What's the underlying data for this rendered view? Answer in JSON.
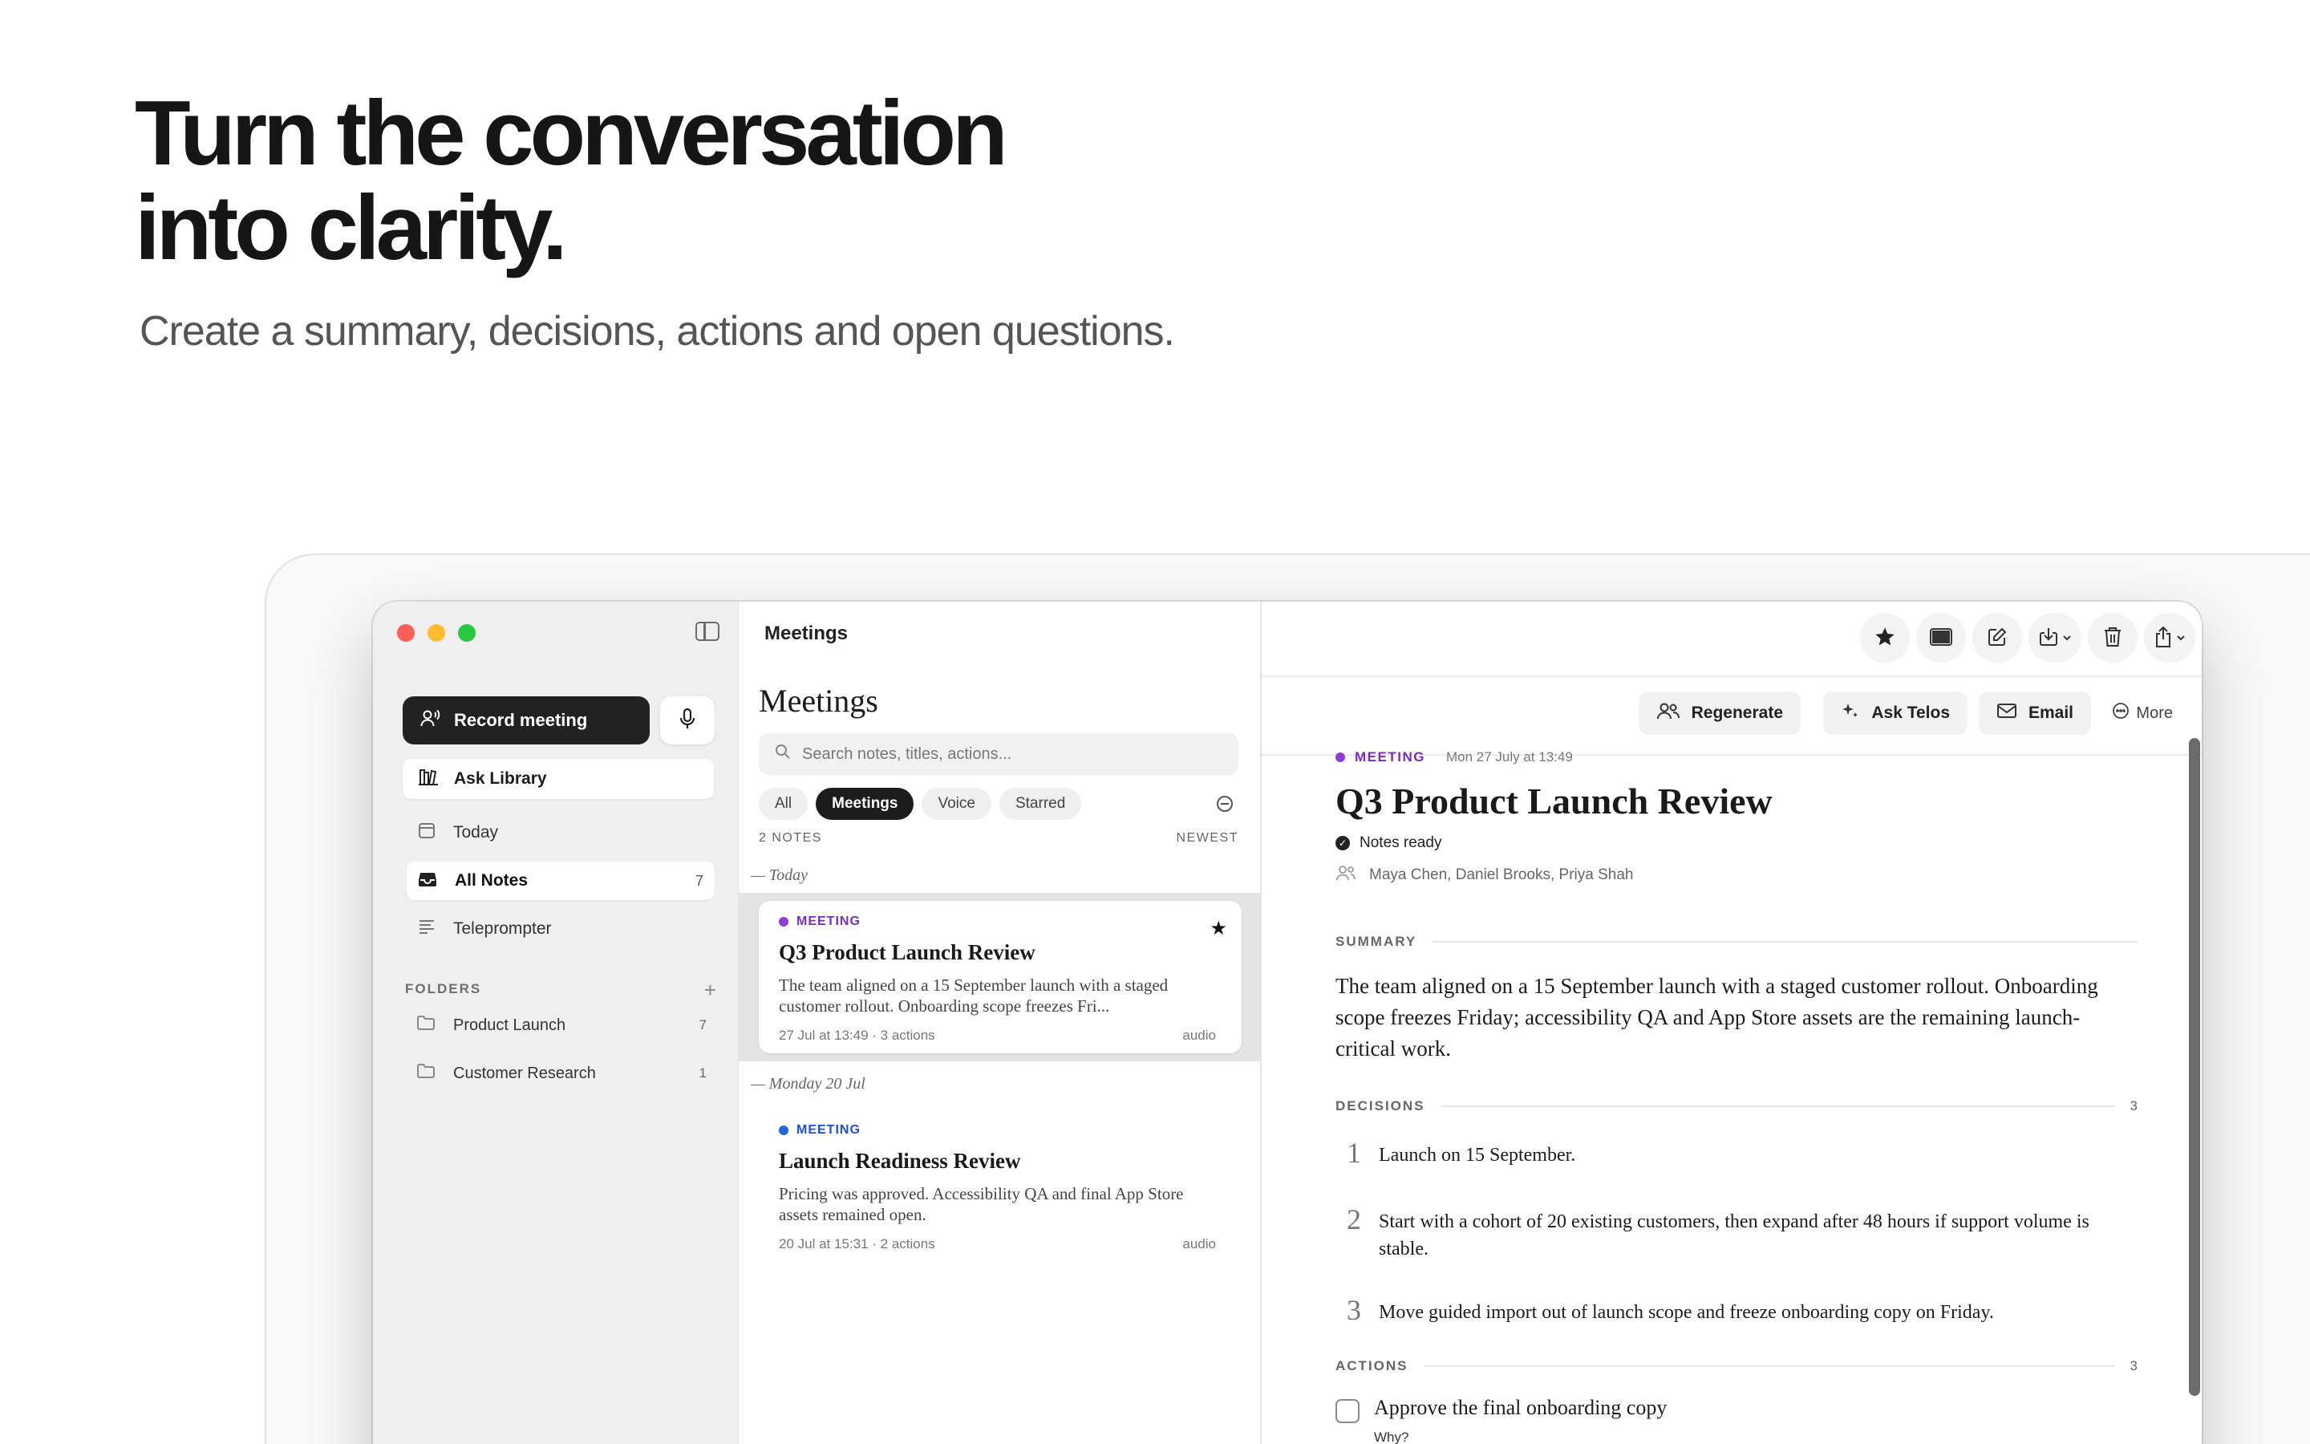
{
  "hero": {
    "title_line1": "Turn the conversation",
    "title_line2": "into clarity.",
    "subtitle": "Create a summary, decisions, actions and open questions."
  },
  "window": {
    "toolbar_title": "Meetings"
  },
  "sidebar": {
    "record_label": "Record meeting",
    "ask_library_label": "Ask Library",
    "nav": [
      {
        "label": "Today",
        "icon": "calendar-icon"
      },
      {
        "label": "All Notes",
        "count": "7",
        "icon": "tray-icon"
      },
      {
        "label": "Teleprompter",
        "icon": "text-lines-icon"
      }
    ],
    "folders_heading": "FOLDERS",
    "folders": [
      {
        "label": "Product Launch",
        "count": "7"
      },
      {
        "label": "Customer Research",
        "count": "1"
      }
    ]
  },
  "list": {
    "heading": "Meetings",
    "search_placeholder": "Search notes, titles, actions...",
    "filters": [
      "All",
      "Meetings",
      "Voice",
      "Starred"
    ],
    "active_filter": "Meetings",
    "count_label": "2  NOTES",
    "sort_label": "NEWEST",
    "groups": [
      {
        "day": "— Today",
        "note": {
          "tag": "MEETING",
          "tag_color": "#8e3ed7",
          "title": "Q3 Product Launch Review",
          "snippet": "The team aligned on a 15 September launch with a staged customer rollout. Onboarding scope freezes Fri...",
          "meta": "27 Jul at 13:49  ·  3 actions",
          "kind": "audio",
          "starred": true
        }
      },
      {
        "day": "— Monday 20 Jul",
        "note": {
          "tag": "MEETING",
          "tag_color": "#2563eb",
          "title": "Launch Readiness Review",
          "snippet": "Pricing was approved. Accessibility QA and final App Store assets remained open.",
          "meta": "20 Jul at 15:31  ·  2 actions",
          "kind": "audio",
          "starred": false
        }
      }
    ]
  },
  "detail": {
    "actions": {
      "regenerate": "Regenerate",
      "ask": "Ask Telos",
      "email": "Email",
      "more": "More"
    },
    "tag": "MEETING",
    "date": "Mon 27 July at 13:49",
    "title": "Q3 Product Launch Review",
    "status": "Notes ready",
    "participants": "Maya Chen, Daniel Brooks, Priya Shah",
    "summary_heading": "SUMMARY",
    "summary": "The team aligned on a 15 September launch with a staged customer rollout. Onboarding scope freezes Friday; accessibility QA and App Store assets are the remaining launch-critical work.",
    "decisions_heading": "DECISIONS",
    "decisions_count": "3",
    "decisions": [
      {
        "n": "1",
        "text": "Launch on 15 September."
      },
      {
        "n": "2",
        "text": "Start with a cohort of 20 existing customers, then expand after 48 hours if support volume is stable."
      },
      {
        "n": "3",
        "text": "Move guided import out of launch scope and freeze onboarding copy on Friday."
      }
    ],
    "actions_heading": "ACTIONS",
    "actions_count": "3",
    "action_items": [
      {
        "text": "Approve the final onboarding copy",
        "sub": "Why?"
      }
    ]
  }
}
